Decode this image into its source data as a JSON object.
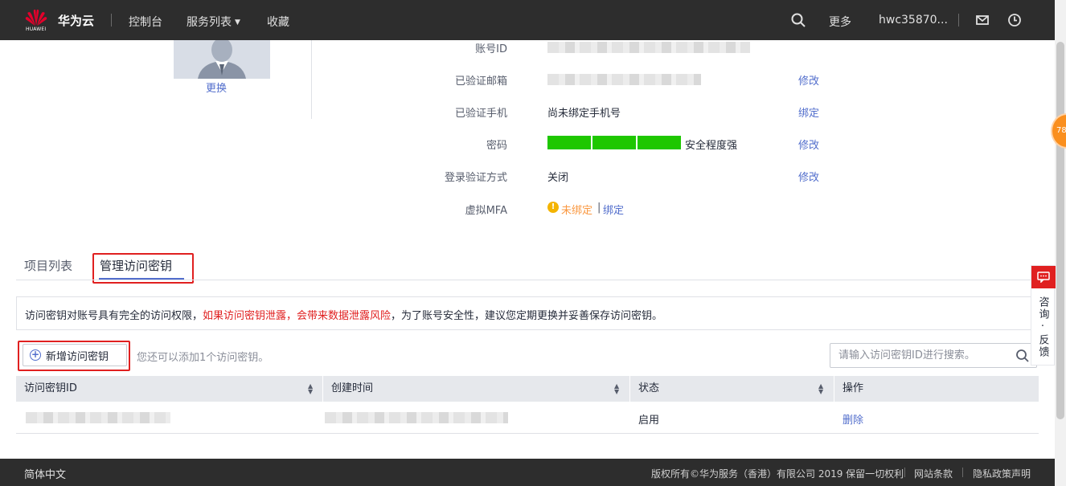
{
  "topnav": {
    "logo_text": "HUAWEI",
    "brand": "华为云",
    "console": "控制台",
    "services": "服务列表",
    "favorites": "收藏",
    "more": "更多",
    "username": "hwc35870..."
  },
  "profile": {
    "change_avatar": "更换",
    "fields": {
      "account_id_label": "账号ID",
      "email_label": "已验证邮箱",
      "email_action": "修改",
      "phone_label": "已验证手机",
      "phone_value": "尚未绑定手机号",
      "phone_action": "绑定",
      "password_label": "密码",
      "password_strength": "安全程度强",
      "password_action": "修改",
      "login_verify_label": "登录验证方式",
      "login_verify_value": "关闭",
      "login_verify_action": "修改",
      "mfa_label": "虚拟MFA",
      "mfa_status": "未绑定",
      "mfa_separator": "|",
      "mfa_action": "绑定"
    }
  },
  "tabs": {
    "projects": "项目列表",
    "access_keys": "管理访问密钥"
  },
  "notice": {
    "part1": "访问密钥对账号具有完全的访问权限，",
    "part2_red": "如果访问密钥泄露，会带来数据泄露风险",
    "part3": "，为了账号安全性，建议您定期更换并妥善保存访问密钥。"
  },
  "toolbar": {
    "add_button": "新增访问密钥",
    "hint": "您还可以添加1个访问密钥。",
    "search_placeholder": "请输入访问密钥ID进行搜索。"
  },
  "table": {
    "columns": [
      "访问密钥ID",
      "创建时间",
      "状态",
      "操作"
    ],
    "rows": [
      {
        "status": "启用",
        "action": "删除"
      }
    ]
  },
  "side": {
    "badge": "78",
    "feedback": "咨询·反馈"
  },
  "footer": {
    "language": "简体中文",
    "copyright": "版权所有©华为服务（香港）有限公司 2019 保留一切权利",
    "terms": "网站条款",
    "privacy": "隐私政策声明"
  },
  "colors": {
    "nav_bg": "#2d2d2d",
    "link": "#526ecc",
    "strength_green": "#1ec700",
    "warning": "#fa9841",
    "danger": "#e02020"
  }
}
